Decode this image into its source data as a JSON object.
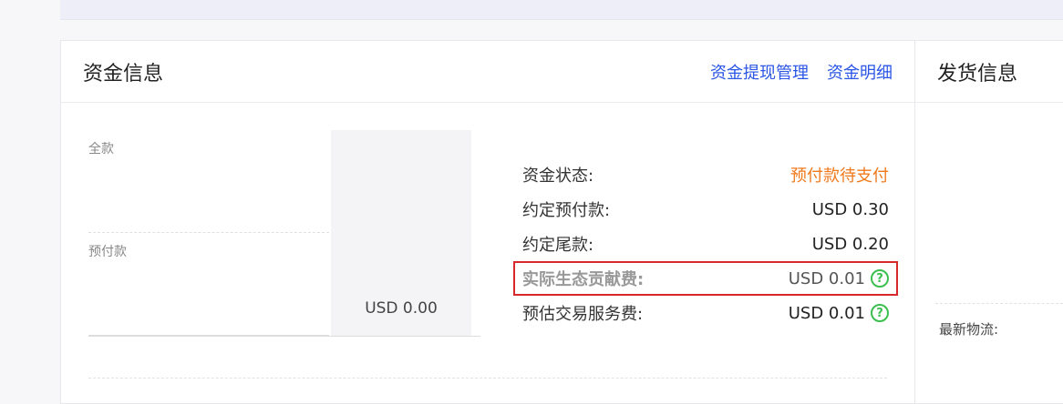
{
  "funds_panel": {
    "title": "资金信息",
    "links": [
      "资金提现管理",
      "资金明细"
    ],
    "summary": {
      "label_full": "全款",
      "label_prepay": "预付款",
      "amount": "USD 0.00"
    },
    "details": [
      {
        "label": "资金状态:",
        "value": "预付款待支付",
        "status": true
      },
      {
        "label": "约定预付款:",
        "value": "USD 0.30"
      },
      {
        "label": "约定尾款:",
        "value": "USD 0.20"
      },
      {
        "label": "实际生态贡献费:",
        "value": "USD 0.01",
        "help": true,
        "highlight": true
      },
      {
        "label": "预估交易服务费:",
        "value": "USD 0.01",
        "help": true
      }
    ]
  },
  "shipping_panel": {
    "title": "发货信息",
    "latest_logistics_label": "最新物流:"
  },
  "colors": {
    "link": "#2a55e5",
    "status_orange": "#f07a1c",
    "highlight_red": "#d9282b",
    "help_green": "#3cbf4e"
  },
  "icons": {
    "help": "question-circle-icon"
  }
}
